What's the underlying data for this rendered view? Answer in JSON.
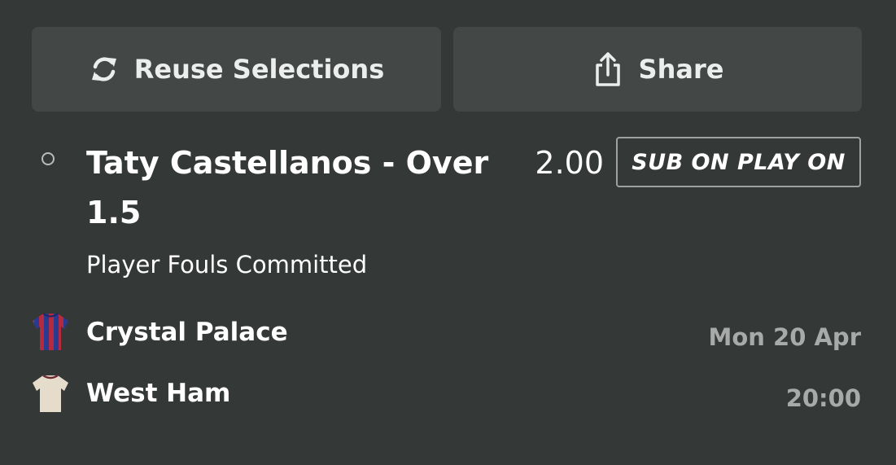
{
  "actions": {
    "reuse_label": "Reuse Selections",
    "reuse_icon": "refresh-icon",
    "share_label": "Share",
    "share_icon": "share-icon"
  },
  "selection": {
    "title": "Taty Castellanos - Over 1.5",
    "odds": "2.00",
    "badge": "SUB ON PLAY ON",
    "market": "Player Fouls Committed"
  },
  "event": {
    "home_team": "Crystal Palace",
    "away_team": "West Ham",
    "date": "Mon 20 Apr",
    "time": "20:00"
  },
  "colors": {
    "background": "#343836",
    "button": "#434745",
    "muted_text": "#a7aaa8",
    "home_kit_red": "#b42a3e",
    "home_kit_blue": "#2a3b8f",
    "away_kit": "#e6dccb"
  }
}
